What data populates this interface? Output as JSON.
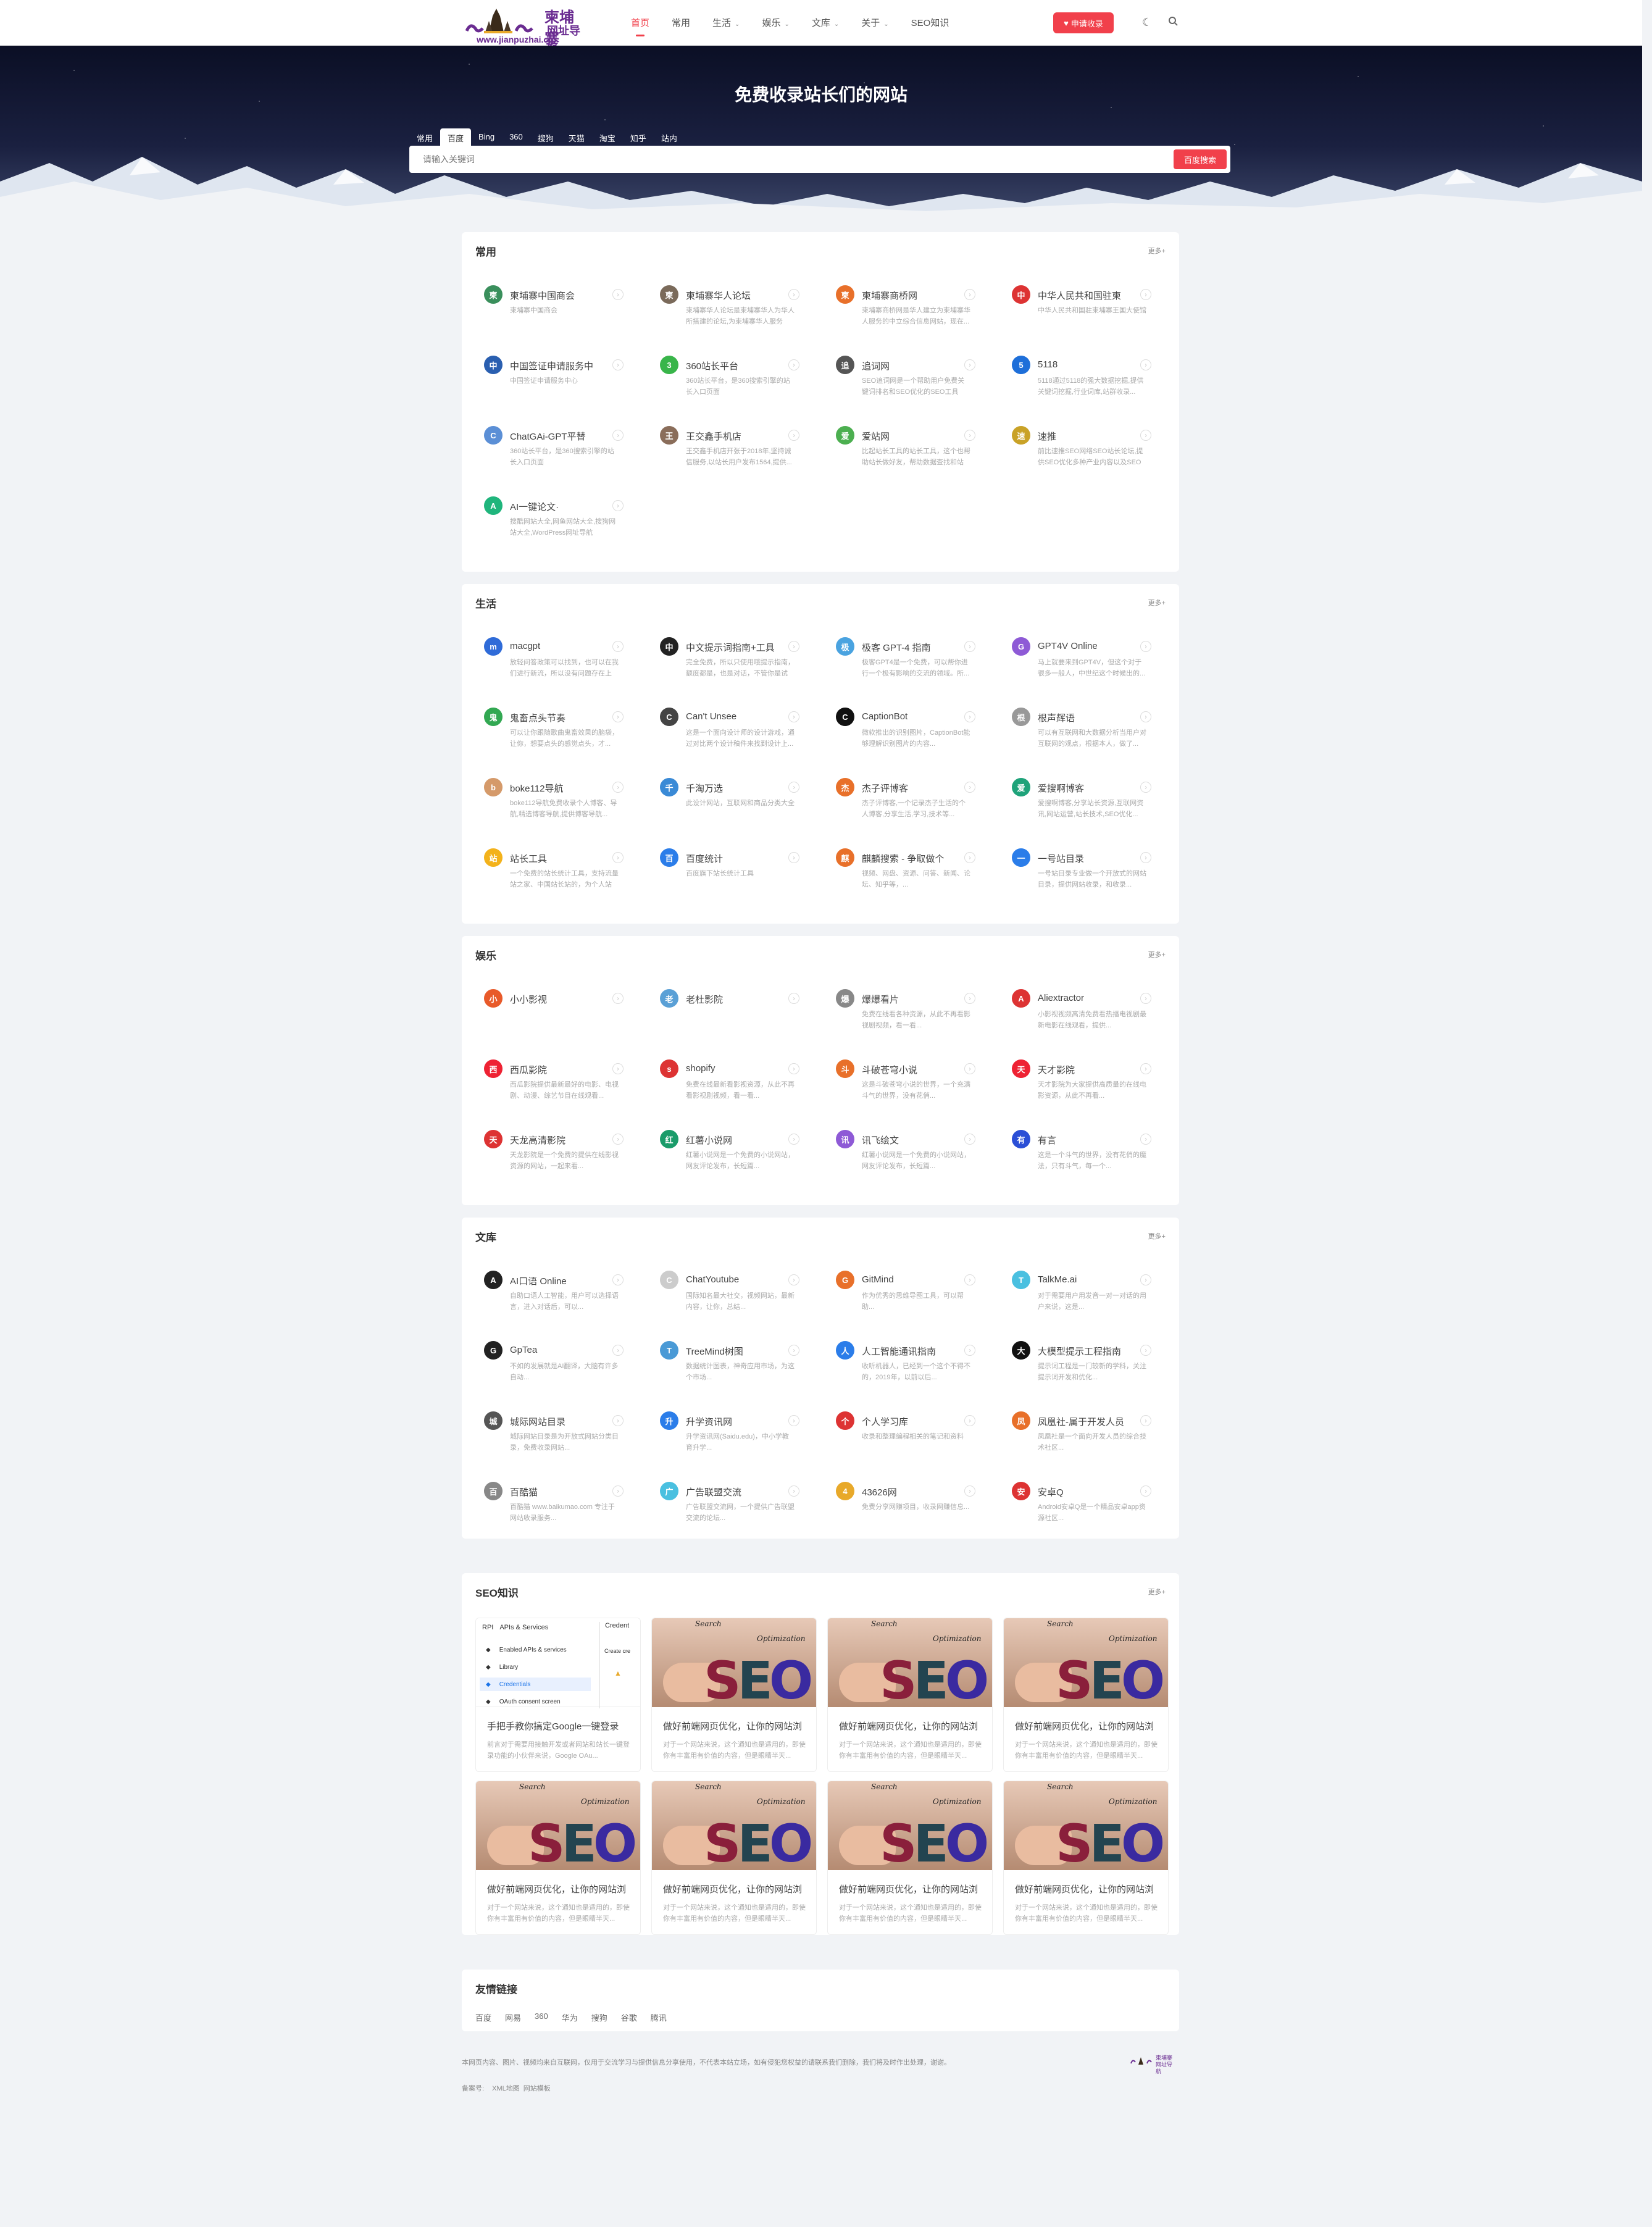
{
  "header": {
    "logo_main": "柬埔寨",
    "logo_sub": "网址导航",
    "logo_url": "www.jianpuzhai.cn",
    "nav": [
      {
        "label": "首页",
        "dropdown": false,
        "active": true
      },
      {
        "label": "常用",
        "dropdown": false,
        "active": false
      },
      {
        "label": "生活",
        "dropdown": true,
        "active": false
      },
      {
        "label": "娱乐",
        "dropdown": true,
        "active": false
      },
      {
        "label": "文库",
        "dropdown": true,
        "active": false
      },
      {
        "label": "关于",
        "dropdown": true,
        "active": false
      },
      {
        "label": "SEO知识",
        "dropdown": false,
        "active": false
      }
    ],
    "submit_label": "申请收录",
    "accent": "#f1404b"
  },
  "hero": {
    "title": "免费收录站长们的网站",
    "tabs": [
      "常用",
      "百度",
      "Bing",
      "360",
      "搜狗",
      "天猫",
      "淘宝",
      "知乎",
      "站内"
    ],
    "active_tab": "百度",
    "placeholder": "请输入关键词",
    "search_button": "百度搜索"
  },
  "sections": [
    {
      "title": "常用",
      "more": "更多+",
      "sites": [
        {
          "name": "柬埔寨中国商会",
          "desc": "柬埔寨中国商会",
          "color": "#3a8f5c"
        },
        {
          "name": "柬埔寨华人论坛",
          "desc": "柬埔寨华人论坛是柬埔寨华人为华人所搭建的论坛,为柬埔寨华人服务的...",
          "color": "#7a6a5a"
        },
        {
          "name": "柬埔寨商桥网",
          "desc": "柬埔寨商桥网是华人建立为柬埔寨华人服务的中立综合信息网站，现在...",
          "color": "#e8702a"
        },
        {
          "name": "中华人民共和国驻柬",
          "desc": "中华人民共和国驻柬埔寨王国大使馆",
          "color": "#d33"
        },
        {
          "name": "中国签证申请服务中",
          "desc": "中国签证申请服务中心",
          "color": "#2a5fb0"
        },
        {
          "name": "360站长平台",
          "desc": "360站长平台，是360搜索引擎的站长入口页面",
          "color": "#39b54a"
        },
        {
          "name": "追词网",
          "desc": "SEO追词网是一个帮助用户免费关键词排名和SEO优化的SEO工具（关键...",
          "color": "#555"
        },
        {
          "name": "5118",
          "desc": "5118通过5118的强大数据挖掘,提供关键词挖掘,行业词库,站群收录...",
          "color": "#1e6fd9"
        },
        {
          "name": "ChatGAi-GPT平替",
          "desc": "360站长平台，是360搜索引擎的站长入口页面",
          "color": "#5b8fd6"
        },
        {
          "name": "王交鑫手机店",
          "desc": "王交鑫手机店开张于2018年,坚持诚信服务,以站长用户发布1564,提供...",
          "color": "#8a6d5a"
        },
        {
          "name": "爱站网",
          "desc": "比起站长工具的站长工具，这个也帮助站长做好友，帮助数据查找和站长...",
          "color": "#4caf50"
        },
        {
          "name": "速推",
          "desc": "前比速推SEO网络SEO站长论坛,提供SEO优化多种产业内容以及SEO优化...",
          "color": "#c9a227"
        },
        {
          "name": "AI一键论文·",
          "desc": "搜酷网站大全,网鱼网站大全,搜狗网站大全,WordPress网址导航",
          "color": "#1fb57c"
        }
      ]
    },
    {
      "title": "生活",
      "more": "更多+",
      "sites": [
        {
          "name": "macgpt",
          "desc": "放轻问答政策可以找到，也可以在我们进行新流，所以没有问题存在上相...",
          "color": "#2f6bd8"
        },
        {
          "name": "中文提示词指南+工具",
          "desc": "完全免费，所以只使用哦提示指南，额度都是，也是对话，不管你是试用...",
          "color": "#222"
        },
        {
          "name": "极客 GPT-4 指南",
          "desc": "极客GPT4是一个免费，可以帮你进行一个极有影响的交流的领域。所...",
          "color": "#4aa3e0"
        },
        {
          "name": "GPT4V Online",
          "desc": "马上就要来到GPT4V，但这个对于很多一般人，中世纪这个时候出的...",
          "color": "#8e5ad6"
        },
        {
          "name": "鬼畜点头节奏",
          "desc": "可以让你跟随歌曲鬼畜效果的脑袋，让你，想要点头的感觉点头，才...",
          "color": "#32a852"
        },
        {
          "name": "Can't Unsee",
          "desc": "这是一个面向设计师的设计游戏，通过对比两个设计稿件来找到设计上...",
          "color": "#444"
        },
        {
          "name": "CaptionBot",
          "desc": "微软推出的识别图片，CaptionBot能够理解识别图片的内容...",
          "color": "#111"
        },
        {
          "name": "根声辉语",
          "desc": "可以有互联网和大数据分析当用户对互联网的观点，根据本人，做了...",
          "color": "#999"
        },
        {
          "name": "boke112导航",
          "desc": "boke112导航免费收录个人博客、导航,精选博客导航,提供博客导航...",
          "color": "#d59a6a"
        },
        {
          "name": "千淘万选",
          "desc": "此设计网站，互联网和商品分类大全",
          "color": "#3a8ad6"
        },
        {
          "name": "杰子评博客",
          "desc": "杰子评博客,一个记录杰子生活的个人博客,分享生活,学习,技术等...",
          "color": "#e8702a"
        },
        {
          "name": "爱搜啊博客",
          "desc": "爱搜啊博客,分享站长资源,互联网资讯,网站运营,站长技术,SEO优化...",
          "color": "#1fa37a"
        },
        {
          "name": "站长工具",
          "desc": "一个免费的站长统计工具，支持流量站之家、中国站长站的，为个人站长...",
          "color": "#f3b21b"
        },
        {
          "name": "百度统计",
          "desc": "百度旗下站长统计工具",
          "color": "#2b7de9"
        },
        {
          "name": "麒麟搜索 - 争取做个",
          "desc": "视频、网盘、资源、问答、新闻、论坛、知乎等，...",
          "color": "#e8702a"
        },
        {
          "name": "一号站目录",
          "desc": "一号站目录专业做一个开放式的网站目录，提供网站收录，和收录...",
          "color": "#2b7de9"
        }
      ]
    },
    {
      "title": "娱乐",
      "more": "更多+",
      "sites": [
        {
          "name": "小小影视",
          "desc": "",
          "color": "#e85a2a"
        },
        {
          "name": "老杜影院",
          "desc": "",
          "color": "#5aa0d6"
        },
        {
          "name": "爆爆看片",
          "desc": "免费在线看各种资源，从此不再看影视剧视频，看一看...",
          "color": "#888"
        },
        {
          "name": "Aliextractor",
          "desc": "小影视视频高清免费看热播电视剧最新电影在线观看，提供...",
          "color": "#d33"
        },
        {
          "name": "西瓜影院",
          "desc": "西瓜影院提供最新最好的电影、电视剧、动漫、综艺节目在线观看...",
          "color": "#e23"
        },
        {
          "name": "shopify",
          "desc": "免费在线最新看影视资源，从此不再看影视剧视频，看一看...",
          "color": "#d33"
        },
        {
          "name": "斗破苍穹小说",
          "desc": "这是斗破苍穹小说的世界，一个充满斗气的世界，没有花俏...",
          "color": "#e8702a"
        },
        {
          "name": "天才影院",
          "desc": "天才影院为大家提供高质量的在线电影资源，从此不再看...",
          "color": "#e23"
        },
        {
          "name": "天龙高清影院",
          "desc": "天龙影院是一个免费的提供在线影视资源的网站，一起来看...",
          "color": "#d33"
        },
        {
          "name": "红薯小说网",
          "desc": "红薯小说网是一个免费的小说网站，网友评论发布，长短篇...",
          "color": "#1a9c6a"
        },
        {
          "name": "讯飞绘文",
          "desc": "红薯小说网是一个免费的小说网站，网友评论发布，长短篇...",
          "color": "#8e5ad6"
        },
        {
          "name": "有言",
          "desc": "这是一个斗气的世界，没有花俏的魔法，只有斗气，每一个...",
          "color": "#2b4fd6"
        }
      ]
    },
    {
      "title": "文库",
      "more": "更多+",
      "sites": [
        {
          "name": "AI口语 Online",
          "desc": "自助口语人工智能，用户可以选择语言，进入对话后，可以...",
          "color": "#222"
        },
        {
          "name": "ChatYoutube",
          "desc": "国际知名最大社交，视频网站，最新内容，让你，总结...",
          "color": "#ccc"
        },
        {
          "name": "GitMind",
          "desc": "作为优秀的思维导图工具，可以帮助...",
          "color": "#e8702a"
        },
        {
          "name": "TalkMe.ai",
          "desc": "对于需要用户用发音一对一对话的用户来说，这是...",
          "color": "#4ac0e0"
        },
        {
          "name": "GpTea",
          "desc": "不如的发展就是AI翻译，大脑有许多自动...",
          "color": "#222"
        },
        {
          "name": "TreeMind树图",
          "desc": "数据统计图表，神奇应用市场，为这个市场...",
          "color": "#4a9ad6"
        },
        {
          "name": "人工智能通讯指南",
          "desc": "收听机器人，已经到一个这个不得不的，2019年，以前以后...",
          "color": "#2b7de9"
        },
        {
          "name": "大模型提示工程指南",
          "desc": "提示词工程是一门较新的学科，关注提示词开发和优化...",
          "color": "#111"
        },
        {
          "name": "城际网站目录",
          "desc": "城际网站目录是为开放式网站分类目录，免费收录网站...",
          "color": "#555"
        },
        {
          "name": "升学资讯网",
          "desc": "升学资讯网(Saidu.edu)，中小学教育升学...",
          "color": "#2b7de9"
        },
        {
          "name": "个人学习库",
          "desc": "收录和整理编程相关的笔记和资料",
          "color": "#d33"
        },
        {
          "name": "凤凰社-属于开发人员",
          "desc": "凤凰社是一个面向开发人员的综合技术社区...",
          "color": "#e8702a"
        },
        {
          "name": "百酷猫",
          "desc": "百酷猫 www.baikumao.com 专注于网站收录服务...",
          "color": "#888"
        },
        {
          "name": "广告联盟交流",
          "desc": "广告联盟交流网，一个提供广告联盟交流的论坛...",
          "color": "#4ac0e0"
        },
        {
          "name": "43626网",
          "desc": "免费分享网赚项目，收录网赚信息...",
          "color": "#e8a92a"
        },
        {
          "name": "安卓Q",
          "desc": "Android安卓Q是一个精品安卓app资源社区...",
          "color": "#d33"
        }
      ]
    }
  ],
  "seo": {
    "title": "SEO知识",
    "more": "更多+",
    "api_panel": {
      "header": "APIs & Services",
      "side_title": "Credent",
      "side_sub": "Create cre",
      "rows": [
        "Enabled APIs & services",
        "Library",
        "Credentials",
        "OAuth consent screen"
      ]
    },
    "image_words": [
      "Search",
      "Optimization",
      "Engine"
    ],
    "image_letters": [
      "S",
      "E",
      "O"
    ],
    "posts": [
      {
        "title": "手把手教你搞定Google一键登录",
        "desc": "前言对于需要用接触开发或者网站和站长一键登录功能的小伙伴来说，Google OAu..."
      },
      {
        "title": "做好前端网页优化，让你的网站浏",
        "desc": "对于一个网站来说，这个通知也是适用的，即使你有丰富用有价值的内容，但是眼睛半天..."
      },
      {
        "title": "做好前端网页优化，让你的网站浏",
        "desc": "对于一个网站来说，这个通知也是适用的，即使你有丰富用有价值的内容，但是眼睛半天..."
      },
      {
        "title": "做好前端网页优化，让你的网站浏",
        "desc": "对于一个网站来说，这个通知也是适用的，即使你有丰富用有价值的内容，但是眼睛半天..."
      },
      {
        "title": "做好前端网页优化，让你的网站浏",
        "desc": "对于一个网站来说，这个通知也是适用的，即使你有丰富用有价值的内容，但是眼睛半天..."
      },
      {
        "title": "做好前端网页优化，让你的网站浏",
        "desc": "对于一个网站来说，这个通知也是适用的，即使你有丰富用有价值的内容，但是眼睛半天..."
      },
      {
        "title": "做好前端网页优化，让你的网站浏",
        "desc": "对于一个网站来说，这个通知也是适用的，即使你有丰富用有价值的内容，但是眼睛半天..."
      },
      {
        "title": "做好前端网页优化，让你的网站浏",
        "desc": "对于一个网站来说，这个通知也是适用的，即使你有丰富用有价值的内容，但是眼睛半天..."
      }
    ]
  },
  "friend_links": {
    "title": "友情链接",
    "items": [
      "百度",
      "网易",
      "360",
      "华为",
      "搜狗",
      "谷歌",
      "腾讯"
    ]
  },
  "footer": {
    "disclaimer": "本网页内容、图片、视频均来自互联网，仅用于交流学习与提供信息分享使用，不代表本站立场，如有侵犯您权益的请联系我们删除，我们将及时作出处理，谢谢。",
    "icp_label": "备案号:",
    "links": [
      "XML地图",
      "网站模板"
    ],
    "logo_text": "柬埔寨 网址导航"
  }
}
